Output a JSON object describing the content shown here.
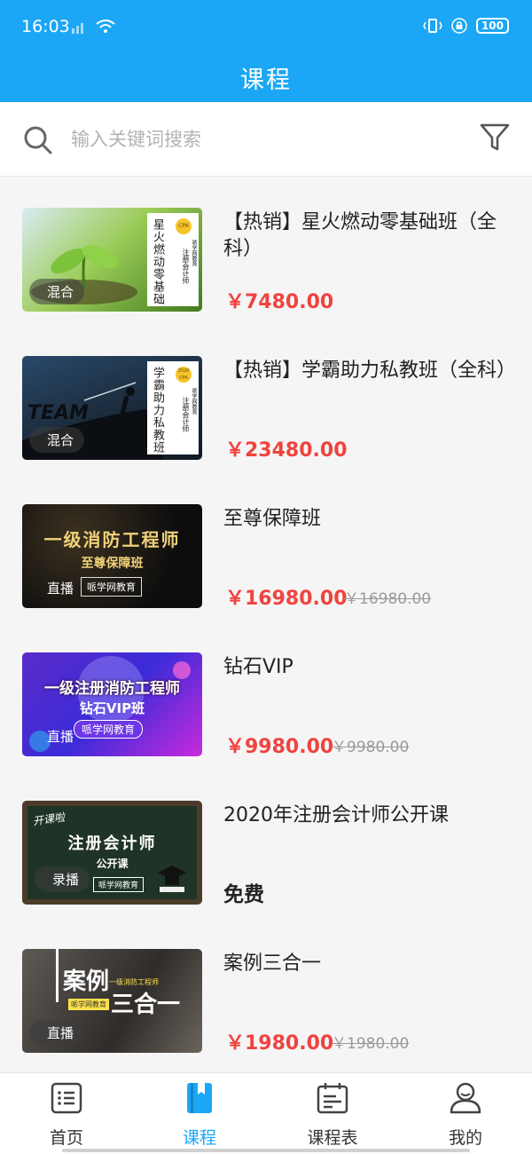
{
  "status": {
    "time": "16:03",
    "battery": "100"
  },
  "header": {
    "title": "课程"
  },
  "search": {
    "placeholder": "输入关键词搜索"
  },
  "courses": [
    {
      "title": "【热销】星火燃动零基础班（全科）",
      "tag": "混合",
      "price": "￥7480.00",
      "old_price": "",
      "thumb": {
        "side_title": "星火燃动零基础",
        "side_sub": "注册会计师",
        "badge": "CPA",
        "brand": "哌学网教育"
      }
    },
    {
      "title": "【热销】学霸助力私教班（全科）",
      "tag": "混合",
      "price": "￥23480.00",
      "old_price": "",
      "thumb": {
        "side_title": "学霸助力私教班",
        "side_sub": "注册会计师",
        "badge": "2020 CPA",
        "brand": "哌学网教育",
        "image_text": "TEAM"
      }
    },
    {
      "title": "至尊保障班",
      "tag": "直播",
      "price": "￥16980.00",
      "old_price": "￥16980.00",
      "thumb": {
        "line1": "一级消防工程师",
        "line2": "至尊保障班",
        "brand": "哌学网教育"
      }
    },
    {
      "title": "钻石VIP",
      "tag": "直播",
      "price": "￥9980.00",
      "old_price": "￥9980.00",
      "thumb": {
        "line1": "一级注册消防工程师",
        "line2": "钻石VIP班",
        "brand": "哌学网教育"
      }
    },
    {
      "title": "2020年注册会计师公开课",
      "tag": "录播",
      "price": "免费",
      "old_price": "",
      "thumb": {
        "line0": "开课啦",
        "line1": "注册会计师",
        "line2": "公开课",
        "brand": "哌学网教育"
      }
    },
    {
      "title": "案例三合一",
      "tag": "直播",
      "price": "￥1980.00",
      "old_price": "￥1980.00",
      "thumb": {
        "line1": "案例",
        "line2": "三合一",
        "small": "一级消防工程师",
        "brand": "哌学网教育"
      }
    }
  ],
  "tabs": [
    {
      "label": "首页",
      "icon": "list-icon"
    },
    {
      "label": "课程",
      "icon": "book-icon"
    },
    {
      "label": "课程表",
      "icon": "schedule-icon"
    },
    {
      "label": "我的",
      "icon": "user-icon"
    }
  ],
  "colors": {
    "primary": "#1ba7f5",
    "price": "#f0433f",
    "muted": "#9a9a9a"
  }
}
